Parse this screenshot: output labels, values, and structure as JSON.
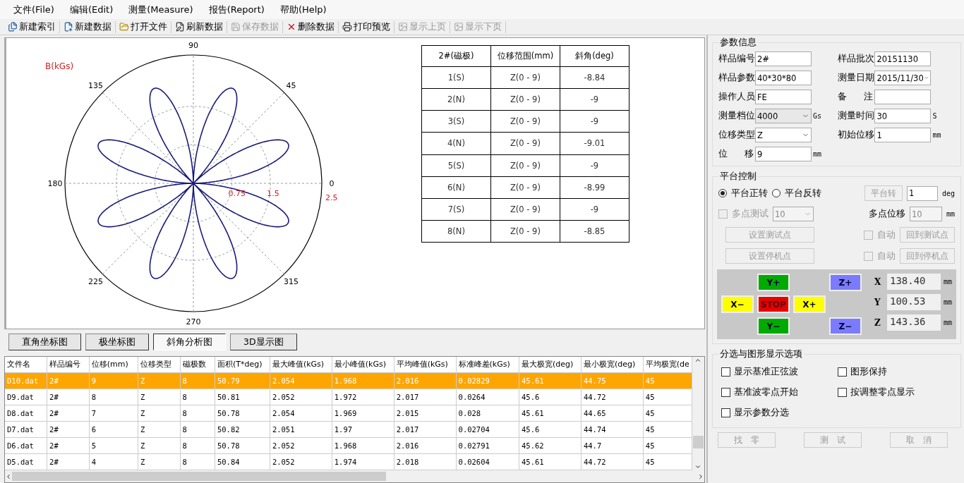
{
  "menu": [
    "文件(File)",
    "编辑(Edit)",
    "测量(Measure)",
    "报告(Report)",
    "帮助(Help)"
  ],
  "toolbar": [
    {
      "label": "新建索引",
      "disabled": false
    },
    {
      "label": "新建数据",
      "disabled": false
    },
    {
      "label": "打开文件",
      "disabled": false
    },
    {
      "label": "刷新数据",
      "disabled": false
    },
    {
      "label": "保存数据",
      "disabled": true
    },
    {
      "label": "删除数据",
      "disabled": false
    },
    {
      "label": "打印预览",
      "disabled": false
    },
    {
      "label": "显示上页",
      "disabled": true
    },
    {
      "label": "显示下页",
      "disabled": true
    }
  ],
  "polar_plot": {
    "unit_label": "B(kGs)",
    "angle_labels": [
      "0",
      "45",
      "90",
      "135",
      "180",
      "225",
      "270",
      "315"
    ],
    "radius_labels": [
      "0.75",
      "1.5",
      "2.5"
    ]
  },
  "angle_table": {
    "columns": [
      "2#(磁极)",
      "位移范围(mm)",
      "斜角(deg)"
    ],
    "rows": [
      [
        "1(S)",
        "Z(0 - 9)",
        "-8.84"
      ],
      [
        "2(N)",
        "Z(0 - 9)",
        "-9"
      ],
      [
        "3(S)",
        "Z(0 - 9)",
        "-9"
      ],
      [
        "4(N)",
        "Z(0 - 9)",
        "-9.01"
      ],
      [
        "5(S)",
        "Z(0 - 9)",
        "-9"
      ],
      [
        "6(N)",
        "Z(0 - 9)",
        "-8.99"
      ],
      [
        "7(S)",
        "Z(0 - 9)",
        "-9"
      ],
      [
        "8(N)",
        "Z(0 - 9)",
        "-8.85"
      ]
    ]
  },
  "view_tabs": [
    {
      "label": "直角坐标图",
      "selected": false
    },
    {
      "label": "极坐标图",
      "selected": false
    },
    {
      "label": "斜角分析图",
      "selected": true
    },
    {
      "label": "3D显示图",
      "selected": false
    }
  ],
  "data_grid": {
    "columns": [
      "文件名",
      "样品编号",
      "位移(mm)",
      "位移类型",
      "磁极数",
      "面积(T*deg)",
      "最大峰值(kGs)",
      "最小峰值(kGs)",
      "平均峰值(kGs)",
      "标准峰差(kGs)",
      "最大极宽(deg)",
      "最小极宽(deg)",
      "平均极宽(de"
    ],
    "rows": [
      {
        "selected": true,
        "cells": [
          "D10.dat",
          "2#",
          "9",
          "Z",
          "8",
          "50.79",
          "2.054",
          "1.968",
          "2.016",
          "0.02829",
          "45.61",
          "44.75",
          "45"
        ]
      },
      {
        "selected": false,
        "cells": [
          "D9.dat",
          "2#",
          "8",
          "Z",
          "8",
          "50.81",
          "2.052",
          "1.972",
          "2.017",
          "0.0264",
          "45.6",
          "44.72",
          "45"
        ]
      },
      {
        "selected": false,
        "cells": [
          "D8.dat",
          "2#",
          "7",
          "Z",
          "8",
          "50.78",
          "2.054",
          "1.969",
          "2.015",
          "0.028",
          "45.61",
          "44.65",
          "45"
        ]
      },
      {
        "selected": false,
        "cells": [
          "D7.dat",
          "2#",
          "6",
          "Z",
          "8",
          "50.82",
          "2.051",
          "1.97",
          "2.017",
          "0.02704",
          "45.6",
          "44.74",
          "45"
        ]
      },
      {
        "selected": false,
        "cells": [
          "D6.dat",
          "2#",
          "5",
          "Z",
          "8",
          "50.78",
          "2.052",
          "1.968",
          "2.016",
          "0.02791",
          "45.62",
          "44.7",
          "45"
        ]
      },
      {
        "selected": false,
        "cells": [
          "D5.dat",
          "2#",
          "4",
          "Z",
          "8",
          "50.84",
          "2.052",
          "1.974",
          "2.018",
          "0.02604",
          "45.61",
          "44.72",
          "45"
        ]
      }
    ]
  },
  "params": {
    "title": "参数信息",
    "fields": [
      {
        "label": "样品编号",
        "value": "2#",
        "kind": "text"
      },
      {
        "label": "样品批次",
        "value": "20151130",
        "kind": "text"
      },
      {
        "label": "样品参数",
        "value": "40*30*80",
        "kind": "text"
      },
      {
        "label": "测量日期",
        "value": "2015/11/30",
        "kind": "select"
      },
      {
        "label": "操作人员",
        "value": "FE",
        "kind": "text"
      },
      {
        "label": "备注",
        "kind": "text"
      },
      {
        "label": "测量档位",
        "value": "4000",
        "kind": "select",
        "unit": "Gs"
      },
      {
        "label": "测量时间",
        "value": "30",
        "kind": "text",
        "unit": "S"
      },
      {
        "label": "位移类型",
        "value": "Z",
        "kind": "select"
      },
      {
        "label": "初始位移",
        "value": "1",
        "kind": "text",
        "unit": "mm"
      },
      {
        "label": "位移",
        "value": "9",
        "kind": "text",
        "unit": "mm"
      }
    ]
  },
  "platform": {
    "title": "平台控制",
    "direction": [
      {
        "label": "平台正转",
        "selected": true
      },
      {
        "label": "平台反转",
        "selected": false
      }
    ],
    "rotate_button": {
      "label": "平台转",
      "disabled": true
    },
    "angle": {
      "value": "1",
      "unit": "deg"
    },
    "multi_test": {
      "label": "多点测试",
      "checked": false,
      "disabled": true,
      "count": "10"
    },
    "multi_offset": {
      "label": "多点位移",
      "value": "10",
      "unit": "mm",
      "disabled": true
    },
    "point_rows": [
      {
        "button": "设置测试点",
        "auto": "自动",
        "auto_checked": false,
        "goto": "回到测试点",
        "disabled": true
      },
      {
        "button": "设置停机点",
        "auto": "自动",
        "auto_checked": false,
        "goto": "回到停机点",
        "disabled": true
      }
    ],
    "jog": [
      {
        "label": "Y+",
        "color": "#00aa00"
      },
      {
        "label": "Z+",
        "color": "#7b7bff"
      },
      {
        "label": "X−",
        "color": "#ffff00"
      },
      {
        "label": "STOP",
        "color": "#e60000"
      },
      {
        "label": "X+",
        "color": "#ffff00"
      },
      {
        "label": "Y−",
        "color": "#00aa00"
      },
      {
        "label": "Z−",
        "color": "#7b7bff"
      }
    ],
    "coords": [
      {
        "axis": "X",
        "value": "138.40",
        "unit": "mm"
      },
      {
        "axis": "Y",
        "value": "100.53",
        "unit": "mm"
      },
      {
        "axis": "Z",
        "value": "143.36",
        "unit": "mm"
      }
    ]
  },
  "options": {
    "title": "分选与图形显示选项",
    "checkboxes": [
      {
        "label": "显示基准正弦波",
        "checked": false
      },
      {
        "label": "图形保持",
        "checked": false
      },
      {
        "label": "基准波零点开始",
        "checked": false
      },
      {
        "label": "按调整零点显示",
        "checked": false
      },
      {
        "label": "显示参数分选",
        "checked": false
      }
    ]
  },
  "footer_buttons": [
    {
      "label": "找　零",
      "disabled": true
    },
    {
      "label": "测　试",
      "disabled": true
    },
    {
      "label": "取　消",
      "disabled": true
    }
  ]
}
